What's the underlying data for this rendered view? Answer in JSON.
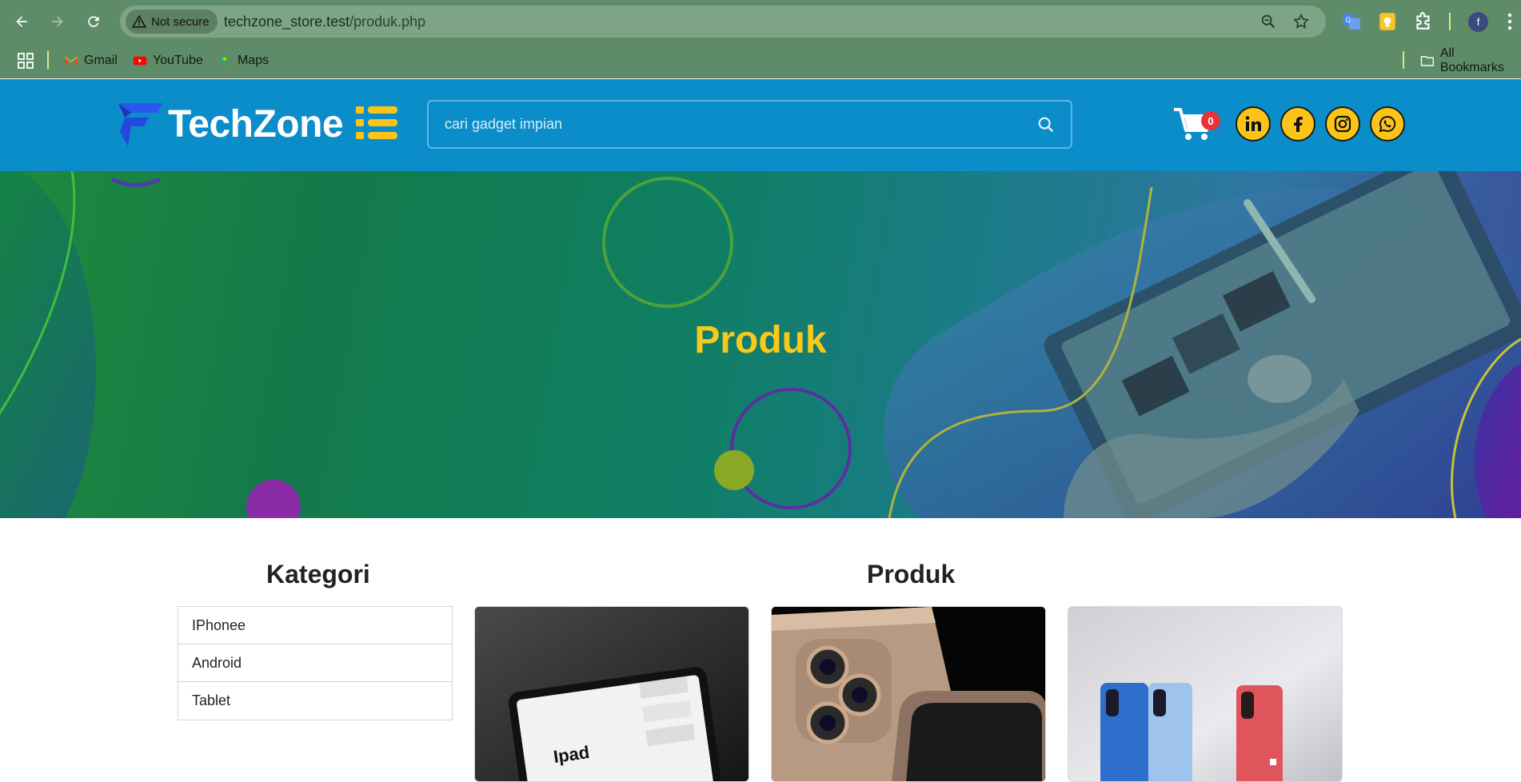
{
  "browser": {
    "security_label": "Not secure",
    "url_host": "techzone_store.test",
    "url_path": "/produk.php",
    "profile_initial": "f",
    "bookmarks": [
      {
        "label": "Gmail",
        "icon": "gmail-icon"
      },
      {
        "label": "YouTube",
        "icon": "youtube-icon"
      },
      {
        "label": "Maps",
        "icon": "maps-icon"
      }
    ],
    "all_bookmarks_label": "All Bookmarks"
  },
  "header": {
    "logo_text": "TechZone",
    "search_placeholder": "cari gadget impian",
    "cart_count": "0",
    "social": [
      "linkedin-icon",
      "facebook-icon",
      "instagram-icon",
      "whatsapp-icon"
    ],
    "colors": {
      "bar": "#0b8dca",
      "accent": "#fcc419",
      "badge": "#e8333b"
    }
  },
  "hero": {
    "title": "Produk"
  },
  "sidebar": {
    "title": "Kategori",
    "items": [
      {
        "label": "IPhonee"
      },
      {
        "label": "Android"
      },
      {
        "label": "Tablet"
      }
    ]
  },
  "products": {
    "title": "Produk",
    "cards": [
      {
        "image_text": "Ipad"
      },
      {
        "image_text": ""
      },
      {
        "image_text": ""
      }
    ]
  }
}
